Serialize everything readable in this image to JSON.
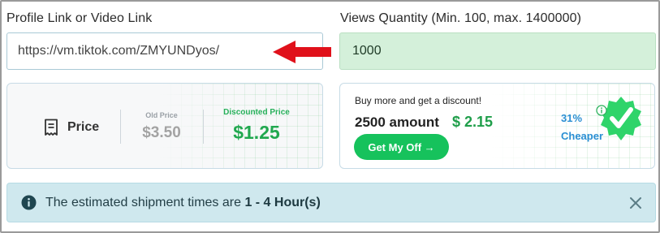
{
  "form": {
    "link_label": "Profile Link or Video Link",
    "link_value": "https://vm.tiktok.com/ZMYUNDyos/",
    "quantity_label": "Views Quantity (Min. 100, max. 1400000)",
    "quantity_value": "1000"
  },
  "price_card": {
    "label": "Price",
    "old_label": "Old Price",
    "old_value": "$3.50",
    "discount_label": "Discounted Price",
    "discount_value": "$1.25"
  },
  "discount_card": {
    "promo_text": "Buy more and get a discount!",
    "amount": "2500 amount",
    "amount_price": "$ 2.15",
    "button_label": "Get My Off →",
    "percent": "31%",
    "cheaper": "Cheaper"
  },
  "alert": {
    "text_prefix": "The estimated shipment times are ",
    "text_bold": "1 - 4 Hour(s)"
  },
  "colors": {
    "green": "#16c25c",
    "arrow_red": "#e0111b",
    "badge_green": "#2fd46a",
    "alert_bg": "#cfe8ee",
    "cheaper_blue": "#2b8fd3"
  },
  "icons": [
    "red-arrow-icon",
    "receipt-icon",
    "info-icon",
    "verified-badge-icon",
    "close-icon"
  ]
}
